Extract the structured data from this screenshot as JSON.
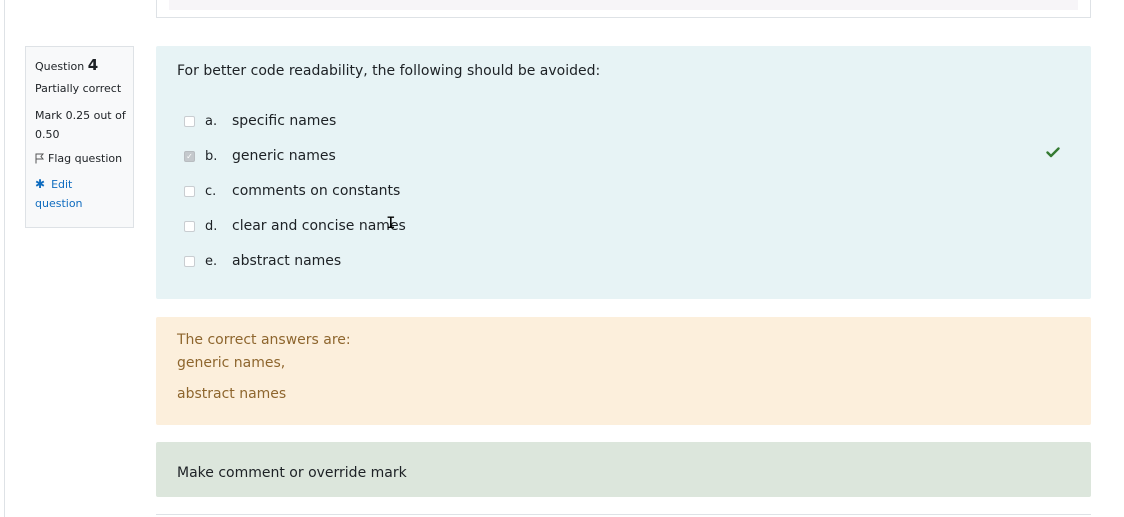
{
  "info": {
    "question_label": "Question",
    "question_number": "4",
    "state": "Partially correct",
    "grade_line1": "Mark 0.25 out of",
    "grade_line2": "0.50",
    "flag_label": "Flag question",
    "edit_line1": "Edit",
    "edit_line2": "question"
  },
  "question": {
    "text": "For better code readability, the following should be avoided:",
    "answers": [
      {
        "letter": "a.",
        "label": "specific names",
        "checked": false
      },
      {
        "letter": "b.",
        "label": "generic names",
        "checked": true
      },
      {
        "letter": "c.",
        "label": "comments on constants",
        "checked": false
      },
      {
        "letter": "d.",
        "label": "clear and concise names",
        "checked": false
      },
      {
        "letter": "e.",
        "label": "abstract names",
        "checked": false
      }
    ]
  },
  "feedback": {
    "heading": "The correct answers are:",
    "line1": "generic names,",
    "line2": "abstract names"
  },
  "comment": {
    "link": "Make comment or override mark"
  },
  "colors": {
    "question_bg": "#e7f3f5",
    "feedback_bg": "#fcefdc",
    "comment_bg": "#dce6dc",
    "correct_tick": "#357a32",
    "link": "#0f6cbf"
  },
  "icons": {
    "flag": "flag-icon",
    "edit": "gear-icon",
    "correct": "check-icon"
  }
}
